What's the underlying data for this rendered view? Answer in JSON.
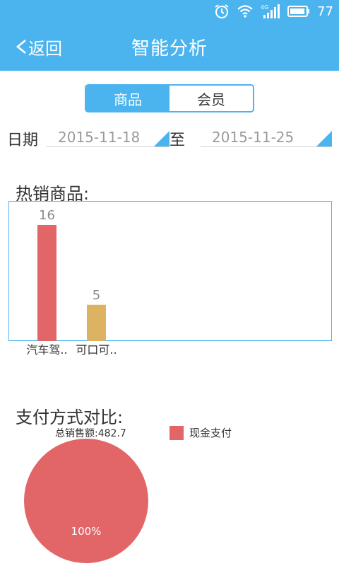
{
  "status_bar": {
    "battery": "77",
    "icons": [
      "alarm-icon",
      "wifi-icon",
      "4g-signal-icon",
      "battery-icon"
    ]
  },
  "header": {
    "back_label": "返回",
    "title": "智能分析"
  },
  "tabs": [
    {
      "label": "商品",
      "active": true
    },
    {
      "label": "会员",
      "active": false
    }
  ],
  "date_range": {
    "date_label": "日期",
    "start": "2015-11-18",
    "to_label": "至",
    "end": "2015-11-25"
  },
  "hot_products": {
    "title": "热销商品:"
  },
  "payment": {
    "title": "支付方式对比:",
    "total_label": "总销售额:482.7"
  },
  "colors": {
    "primary": "#4bb4ee",
    "bar_red": "#e26668",
    "bar_yellow": "#ddb262",
    "pie_red": "#e26668"
  },
  "chart_data": [
    {
      "type": "bar",
      "categories": [
        "汽车驾..",
        "可口可.."
      ],
      "values": [
        16,
        5
      ],
      "colors": [
        "#e26668",
        "#ddb262"
      ],
      "title": "热销商品:",
      "ylim": [
        0,
        16
      ]
    },
    {
      "type": "pie",
      "labels": [
        "现金支付"
      ],
      "values": [
        100
      ],
      "value_labels": [
        "100%"
      ],
      "colors": [
        "#e26668"
      ],
      "title": "支付方式对比:",
      "subtitle": "总销售额:482.7",
      "legend": "top-right"
    }
  ]
}
